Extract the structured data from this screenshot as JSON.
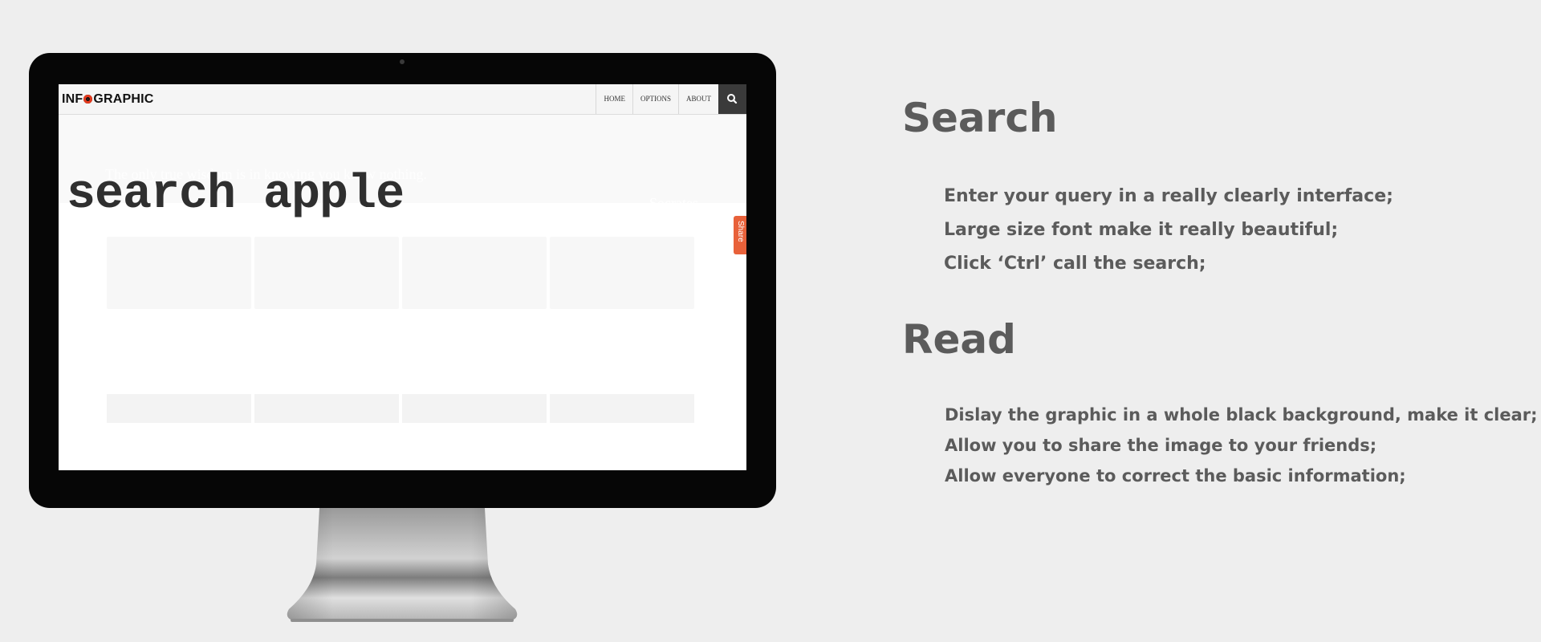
{
  "screen": {
    "logo": {
      "before": "INF",
      "after": "GRAPHIC"
    },
    "nav": [
      "HOME",
      "OPTIONS",
      "ABOUT"
    ],
    "search_button_icon": "search-icon",
    "query": "search apple",
    "share_label": "Share",
    "background_tagline": "The only true wisdom is in knowing you know nothing.",
    "background_word": "Socrates"
  },
  "panel": {
    "search_title": "Search",
    "search_items": [
      "Enter your query in a really clearly interface;",
      "Large size font make it really beautiful;",
      "Click ‘Ctrl’ call the search;"
    ],
    "read_title": "Read",
    "read_items": [
      "Dislay the graphic in a whole black background, make it clear;",
      "Allow you to share the image to your friends;",
      "Allow everyone to correct the basic information;"
    ]
  },
  "colors": {
    "page_background": "#eeeeee",
    "monitor_bezel": "#060606",
    "text_gray": "#5b5b5b",
    "accent_orange": "#e8613a",
    "logo_red": "#e43b1f",
    "search_button_bg": "#3a3a3a"
  }
}
